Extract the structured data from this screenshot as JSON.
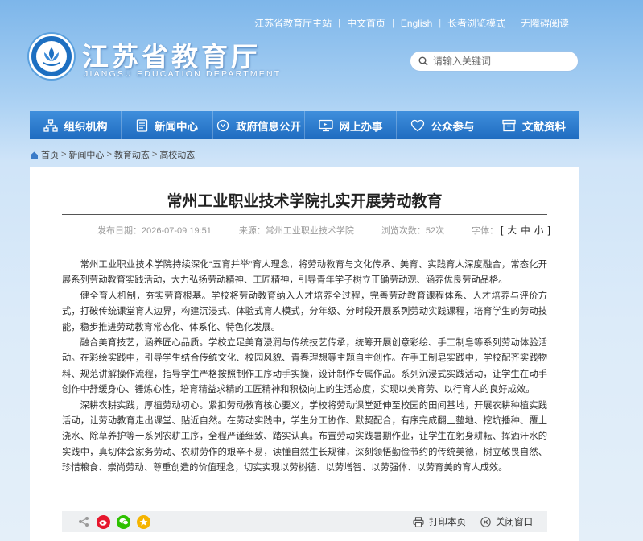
{
  "top_links": [
    "江苏省教育厅主站",
    "中文首页",
    "English",
    "长者浏览模式",
    "无障碍阅读"
  ],
  "site": {
    "title": "江苏省教育厅",
    "subtitle": "JIANGSU EDUCATION DEPARTMENT"
  },
  "search": {
    "placeholder": "请输入关键词"
  },
  "nav": [
    {
      "label": "组织机构",
      "icon": "org-chart-icon"
    },
    {
      "label": "新闻中心",
      "icon": "document-icon"
    },
    {
      "label": "政府信息公开",
      "icon": "disclosure-icon"
    },
    {
      "label": "网上办事",
      "icon": "monitor-icon"
    },
    {
      "label": "公众参与",
      "icon": "heart-icon"
    },
    {
      "label": "文献资料",
      "icon": "archive-icon"
    }
  ],
  "breadcrumb": [
    "首页",
    "新闻中心",
    "教育动态",
    "高校动态"
  ],
  "article": {
    "title": "常州工业职业技术学院扎实开展劳动教育",
    "published": "发布日期：2026-07-09 19:51",
    "source": "来源：常州工业职业技术学院",
    "views": "浏览次数：52次",
    "font_label": "字体：",
    "font_bracket_open": "[",
    "font_bracket_close": "]",
    "font_sizes": [
      "大",
      "中",
      "小"
    ],
    "paragraphs": [
      "常州工业职业技术学院持续深化“五育并举”育人理念，将劳动教育与文化传承、美育、实践育人深度融合，常态化开展系列劳动教育实践活动，大力弘扬劳动精神、工匠精神，引导青年学子树立正确劳动观、涵养优良劳动品格。",
      "健全育人机制，夯实劳育根基。学校将劳动教育纳入人才培养全过程，完善劳动教育课程体系、人才培养与评价方式，打破传统课堂育人边界，构建沉浸式、体验式育人模式，分年级、分时段开展系列劳动实践课程，培育学生的劳动技能，稳步推进劳动教育常态化、体系化、特色化发展。",
      "融合美育技艺，涵养匠心品质。学校立足美育浸润与传统技艺传承，统筹开展创意彩绘、手工制皂等系列劳动体验活动。在彩绘实践中，引导学生结合传统文化、校园风貌、青春理想等主题自主创作。在手工制皂实践中，学校配齐实践物料、规范讲解操作流程，指导学生严格按照制作工序动手实操，设计制作专属作品。系列沉浸式实践活动，让学生在动手创作中舒缓身心、锤炼心性，培育精益求精的工匠精神和积极向上的生活态度，实现以美育劳、以行育人的良好成效。",
      "深耕农耕实践，厚植劳动初心。紧扣劳动教育核心要义，学校将劳动课堂延伸至校园的田间基地，开展农耕种植实践活动，让劳动教育走出课堂、贴近自然。在劳动实践中，学生分工协作、默契配合，有序完成翻土整地、挖坑播种、覆土浇水、除草养护等一系列农耕工序，全程严谨细致、踏实认真。布置劳动实践暑期作业，让学生在躬身耕耘、挥洒汗水的实践中，真切体会家务劳动、农耕劳作的艰辛不易，读懂自然生长规律，深刻领悟勤俭节约的传统美德，树立敬畏自然、珍惜粮食、崇尚劳动、尊重创造的价值理念，切实实现以劳树德、以劳增智、以劳强体、以劳育美的育人成效。"
    ]
  },
  "footer": {
    "print": "打印本页",
    "close": "关闭窗口"
  },
  "colors": {
    "nav_top": "#3f8fdc",
    "nav_bottom": "#1f6cc0",
    "weibo": "#e6162d",
    "wechat": "#2dc100",
    "qzone": "#f5b400"
  }
}
